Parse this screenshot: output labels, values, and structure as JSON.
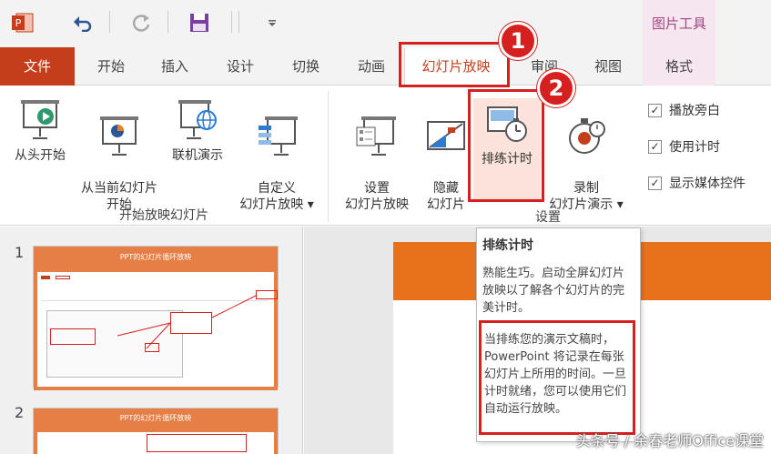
{
  "tabs": [
    "文件",
    "开始",
    "插入",
    "设计",
    "切换",
    "动画",
    "幻灯片放映",
    "审阅",
    "视图",
    "格式"
  ],
  "context_group": "图片工具",
  "ribbon": {
    "group1": {
      "label": "开始放映幻灯片",
      "buttons": [
        "从头开始",
        "从当前幻灯片\n开始",
        "联机演示",
        "自定义\n幻灯片放映 ▾"
      ]
    },
    "group2": {
      "label": "设置",
      "buttons": [
        "设置\n幻灯片放映",
        "隐藏\n幻灯片",
        "排练计时",
        "录制\n幻灯片演示 ▾"
      ]
    },
    "checkboxes": [
      "播放旁白",
      "使用计时",
      "显示媒体控件"
    ]
  },
  "slides": [
    {
      "num": "1",
      "title": "PPT的幻灯片循环放映"
    },
    {
      "num": "2",
      "title": "PPT的幻灯片循环放映"
    }
  ],
  "tooltip": {
    "title": "排练计时",
    "para1": "熟能生巧。启动全屏幻灯片放映以了解各个幻灯片的完美计时。",
    "para2": "当排练您的演示文稿时，PowerPoint 将记录在每张幻灯片上所用的时间。一旦计时就绪，您可以使用它们自动运行放映。"
  },
  "badges": [
    "1",
    "2"
  ],
  "watermark": "头条号 / 余春老师Office课堂",
  "colors": {
    "accent": "#c43e1c",
    "annotation": "#d62020",
    "slide_orange": "#e8711c"
  }
}
